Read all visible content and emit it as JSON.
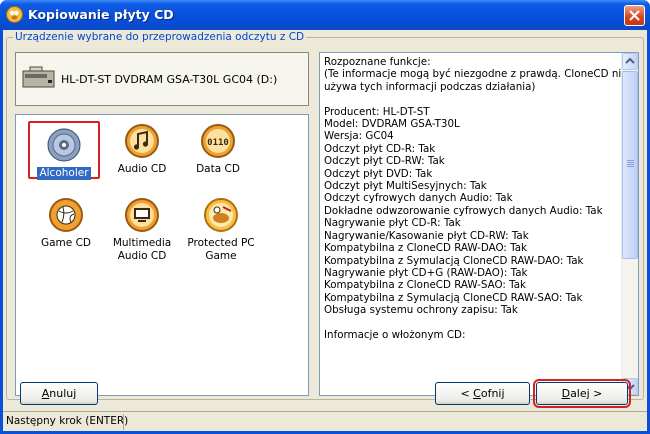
{
  "window": {
    "title": "Kopiowanie płyty CD"
  },
  "group": {
    "label": "Urządzenie wybrane do przeprowadzenia odczytu z CD"
  },
  "device": {
    "name": "HL-DT-ST DVDRAM GSA-T30L GC04 (D:)"
  },
  "tiles": [
    {
      "label": "Alcoholer",
      "icon": "alcoholer-disc-icon",
      "selected": true
    },
    {
      "label": "Audio CD",
      "icon": "music-note-icon",
      "selected": false
    },
    {
      "label": "Data CD",
      "icon": "binary-data-icon",
      "selected": false
    },
    {
      "label": "Game CD",
      "icon": "volleyball-icon",
      "selected": false
    },
    {
      "label": "Multimedia\nAudio CD",
      "icon": "monitor-icon",
      "selected": false
    },
    {
      "label": "Protected PC\nGame",
      "icon": "protected-game-icon",
      "selected": false
    }
  ],
  "info": {
    "lines": [
      "Rozpoznane funkcje:",
      "(Te informacje mogą być niezgodne z prawdą. CloneCD nie",
      "używa tych informacji podczas działania)",
      "",
      "Producent: HL-DT-ST",
      "Model: DVDRAM GSA-T30L",
      "Wersja: GC04",
      "Odczyt płyt CD-R: Tak",
      "Odczyt płyt CD-RW: Tak",
      "Odczyt płyt DVD: Tak",
      "Odczyt płyt MultiSesyjnych: Tak",
      "Odczyt cyfrowych danych Audio: Tak",
      "Dokładne odwzorowanie cyfrowych danych Audio: Tak",
      "Nagrywanie płyt CD-R: Tak",
      "Nagrywanie/Kasowanie płyt CD-RW: Tak",
      "Kompatybilna z CloneCD RAW-DAO: Tak",
      "Kompatybilna z Symulacją CloneCD RAW-DAO: Tak",
      "Nagrywanie płyt CD+G (RAW-DAO): Tak",
      "Kompatybilna z CloneCD RAW-SAO: Tak",
      "Kompatybilna z Symulacją CloneCD RAW-SAO: Tak",
      "Obsługa systemu ochrony zapisu: Tak",
      "",
      "Informacje o włożonym CD:"
    ]
  },
  "buttons": {
    "cancel": {
      "accel": "A",
      "rest": "nuluj"
    },
    "back": {
      "prefix": "< ",
      "accel": "C",
      "rest": "ofnij"
    },
    "next": {
      "accel": "D",
      "rest": "alej",
      "suffix": " >"
    }
  },
  "status": {
    "text": "Następny krok (ENTER)"
  },
  "colors": {
    "title_bar": "#0a4fd8",
    "selection": "#316ac5",
    "highlight_frame": "#d82020",
    "group_label": "#0046d5"
  }
}
